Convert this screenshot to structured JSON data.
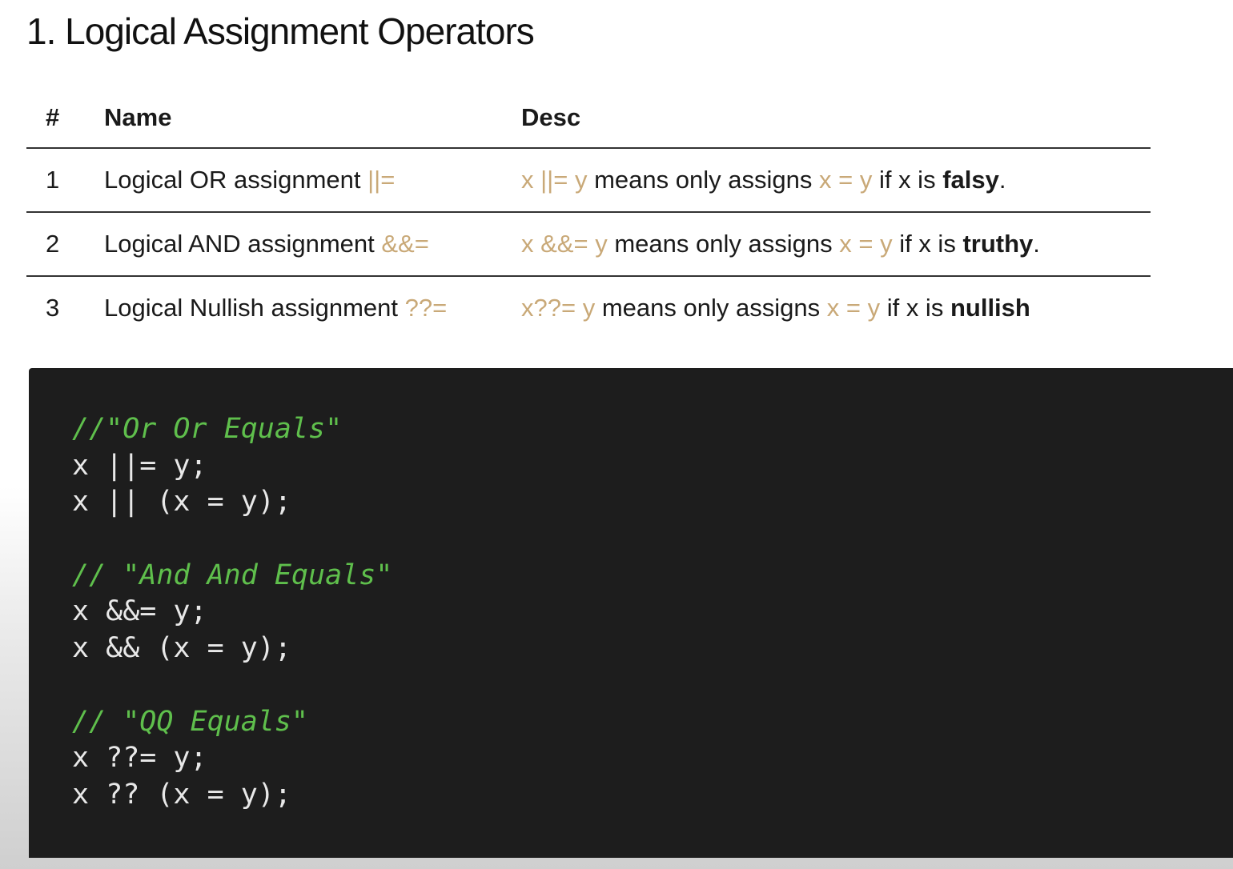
{
  "title": "1. Logical Assignment Operators",
  "table": {
    "headers": {
      "num": "#",
      "name": "Name",
      "desc": "Desc"
    },
    "rows": [
      {
        "num": "1",
        "name": "Logical OR assignment",
        "op": "||=",
        "desc_x": "x",
        "desc_op": "||=",
        "desc_y": "y",
        "desc_mid": "means only assigns",
        "desc_x2": "x",
        "desc_eq": "=",
        "desc_y2": "y",
        "desc_if": "if x is",
        "keyword": "falsy",
        "end": "."
      },
      {
        "num": "2",
        "name": "Logical AND assignment",
        "op": "&&=",
        "desc_x": "x",
        "desc_op": "&&=",
        "desc_y": "y",
        "desc_mid": "means only assigns",
        "desc_x2": "x",
        "desc_eq": "=",
        "desc_y2": "y",
        "desc_if": "if x is",
        "keyword": "truthy",
        "end": "."
      },
      {
        "num": "3",
        "name": "Logical Nullish assignment",
        "op": "??=",
        "desc_x": "x",
        "desc_op": "??=",
        "desc_y": "y",
        "desc_mid": "means only assigns",
        "desc_x2": "x",
        "desc_eq": "=",
        "desc_y2": "y",
        "desc_if": "if x is",
        "keyword": "nullish",
        "end": ""
      }
    ]
  },
  "code": {
    "lines": [
      {
        "type": "comment",
        "text": "//\"Or Or Equals\""
      },
      {
        "type": "code",
        "text": "x ||= y;"
      },
      {
        "type": "code",
        "text": "x || (x = y);"
      },
      {
        "type": "blank",
        "text": ""
      },
      {
        "type": "comment",
        "text": "// \"And And Equals\""
      },
      {
        "type": "code",
        "text": "x &&= y;"
      },
      {
        "type": "code",
        "text": "x && (x = y);"
      },
      {
        "type": "blank",
        "text": ""
      },
      {
        "type": "comment",
        "text": "// \"QQ Equals\""
      },
      {
        "type": "code",
        "text": "x ??= y;"
      },
      {
        "type": "code",
        "text": "x ?? (x = y);"
      }
    ]
  },
  "colors": {
    "operator": "#c9a978",
    "comment": "#5fbf4c",
    "code_bg": "#1d1d1d",
    "code_text": "#e8e8e8"
  }
}
